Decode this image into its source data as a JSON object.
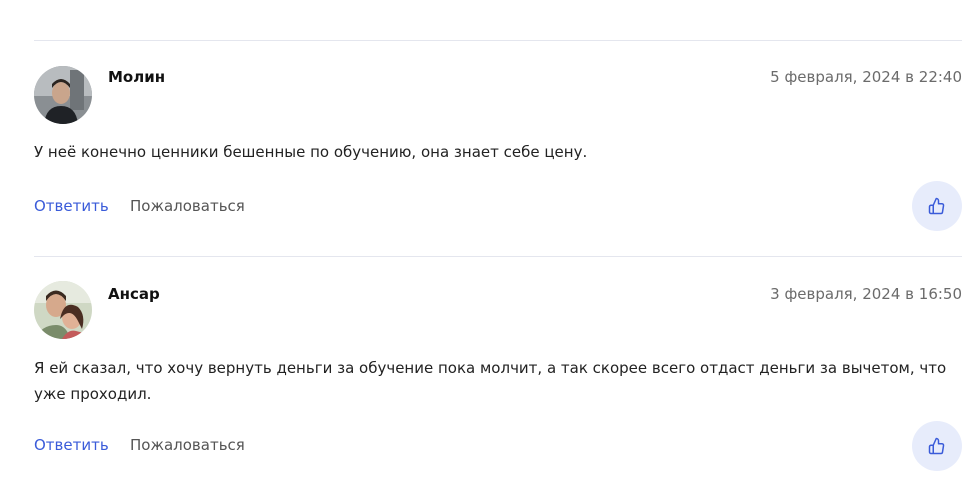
{
  "comments": [
    {
      "author": "Молин",
      "date": "5 февраля, 2024 в 22:40",
      "text": "У неё конечно ценники бешенные по обучению, она знает себе цену.",
      "reply_label": "Ответить",
      "report_label": "Пожаловаться",
      "avatar_icon": "user-photo-avatar",
      "like_icon": "thumbs-up-icon"
    },
    {
      "author": "Ансар",
      "date": "3 февраля, 2024 в 16:50",
      "text": "Я ей сказал, что хочу вернуть деньги за обучение пока молчит, а так скорее всего отдаст деньги за вычетом, что уже проходил.",
      "reply_label": "Ответить",
      "report_label": "Пожаловаться",
      "avatar_icon": "user-photo-avatar",
      "like_icon": "thumbs-up-icon"
    }
  ],
  "colors": {
    "accent": "#3a5bd9",
    "like_bg": "#e7ecfb",
    "divider": "#e4e6ee",
    "muted": "#6b6b6b"
  }
}
